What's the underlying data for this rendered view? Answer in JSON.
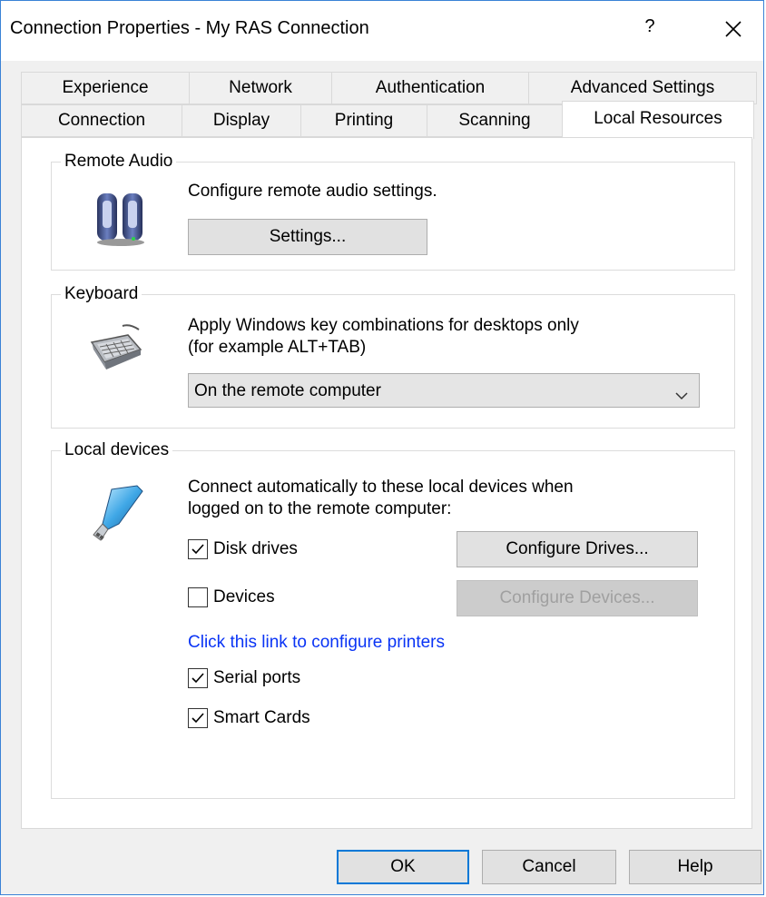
{
  "window": {
    "title": "Connection Properties - My RAS Connection",
    "help_glyph": "?",
    "close_icon": "close-icon"
  },
  "tabs": {
    "row_back": [
      "Experience",
      "Network",
      "Authentication",
      "Advanced Settings"
    ],
    "row_front": [
      "Connection",
      "Display",
      "Printing",
      "Scanning",
      "Local Resources"
    ],
    "active": "Local Resources"
  },
  "remote_audio": {
    "group_label": "Remote Audio",
    "description": "Configure remote audio settings.",
    "settings_button": "Settings...",
    "icon": "speakers-icon"
  },
  "keyboard": {
    "group_label": "Keyboard",
    "description_line1": "Apply Windows key combinations for desktops only",
    "description_line2": "(for example ALT+TAB)",
    "selected_option": "On the remote computer",
    "icon": "keyboard-icon"
  },
  "local_devices": {
    "group_label": "Local devices",
    "description_line1": "Connect automatically to these local devices when",
    "description_line2": "logged on to the remote computer:",
    "icon": "usb-drive-icon",
    "disk_drives": {
      "label": "Disk drives",
      "checked": true
    },
    "devices": {
      "label": "Devices",
      "checked": false
    },
    "configure_drives_button": "Configure Drives...",
    "configure_devices_button": "Configure Devices...",
    "printers_link": "Click this link to configure printers",
    "serial_ports": {
      "label": "Serial ports",
      "checked": true
    },
    "smart_cards": {
      "label": "Smart Cards",
      "checked": true
    }
  },
  "footer": {
    "ok": "OK",
    "cancel": "Cancel",
    "help": "Help"
  },
  "colors": {
    "link": "#0a34f5",
    "default_button_border": "#0078d7",
    "window_border": "#3a82d6"
  }
}
